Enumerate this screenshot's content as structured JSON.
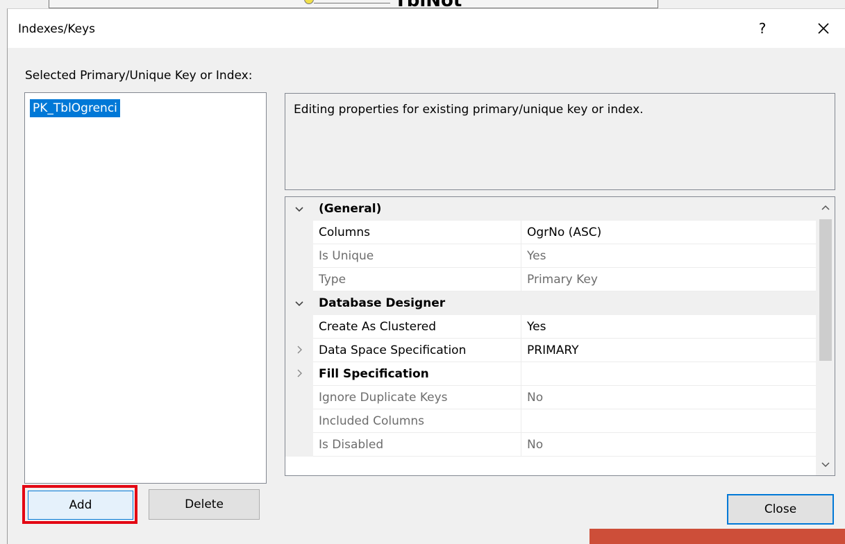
{
  "background_window": {
    "table_title": "TblNot"
  },
  "dialog": {
    "title": "Indexes/Keys",
    "help_label": "?",
    "selected_label": "Selected Primary/Unique Key or Index:",
    "keys": [
      {
        "label": "PK_TblOgrenci",
        "selected": true
      }
    ],
    "description": "Editing properties for existing primary/unique key or index.",
    "properties": [
      {
        "type": "category",
        "label": "(General)",
        "expanded": true
      },
      {
        "type": "prop",
        "name": "Columns",
        "value": "OgrNo (ASC)",
        "enabled": true
      },
      {
        "type": "prop",
        "name": "Is Unique",
        "value": "Yes",
        "enabled": false
      },
      {
        "type": "prop",
        "name": "Type",
        "value": "Primary Key",
        "enabled": false
      },
      {
        "type": "category",
        "label": "Database Designer",
        "expanded": true
      },
      {
        "type": "prop",
        "name": "Create As Clustered",
        "value": "Yes",
        "enabled": true
      },
      {
        "type": "prop",
        "name": "Data Space Specification",
        "value": "PRIMARY",
        "enabled": true,
        "expandable": true
      },
      {
        "type": "prop",
        "name": "Fill Specification",
        "value": "",
        "enabled": true,
        "expandable": true,
        "bold": true
      },
      {
        "type": "prop",
        "name": "Ignore Duplicate Keys",
        "value": "No",
        "enabled": false
      },
      {
        "type": "prop",
        "name": "Included Columns",
        "value": "",
        "enabled": false
      },
      {
        "type": "prop",
        "name": "Is Disabled",
        "value": "No",
        "enabled": false
      }
    ],
    "buttons": {
      "add": "Add",
      "delete": "Delete",
      "close": "Close"
    }
  },
  "colors": {
    "selection": "#0078d7",
    "highlight_box": "#e30613",
    "accent_bar": "#cd4e39"
  }
}
